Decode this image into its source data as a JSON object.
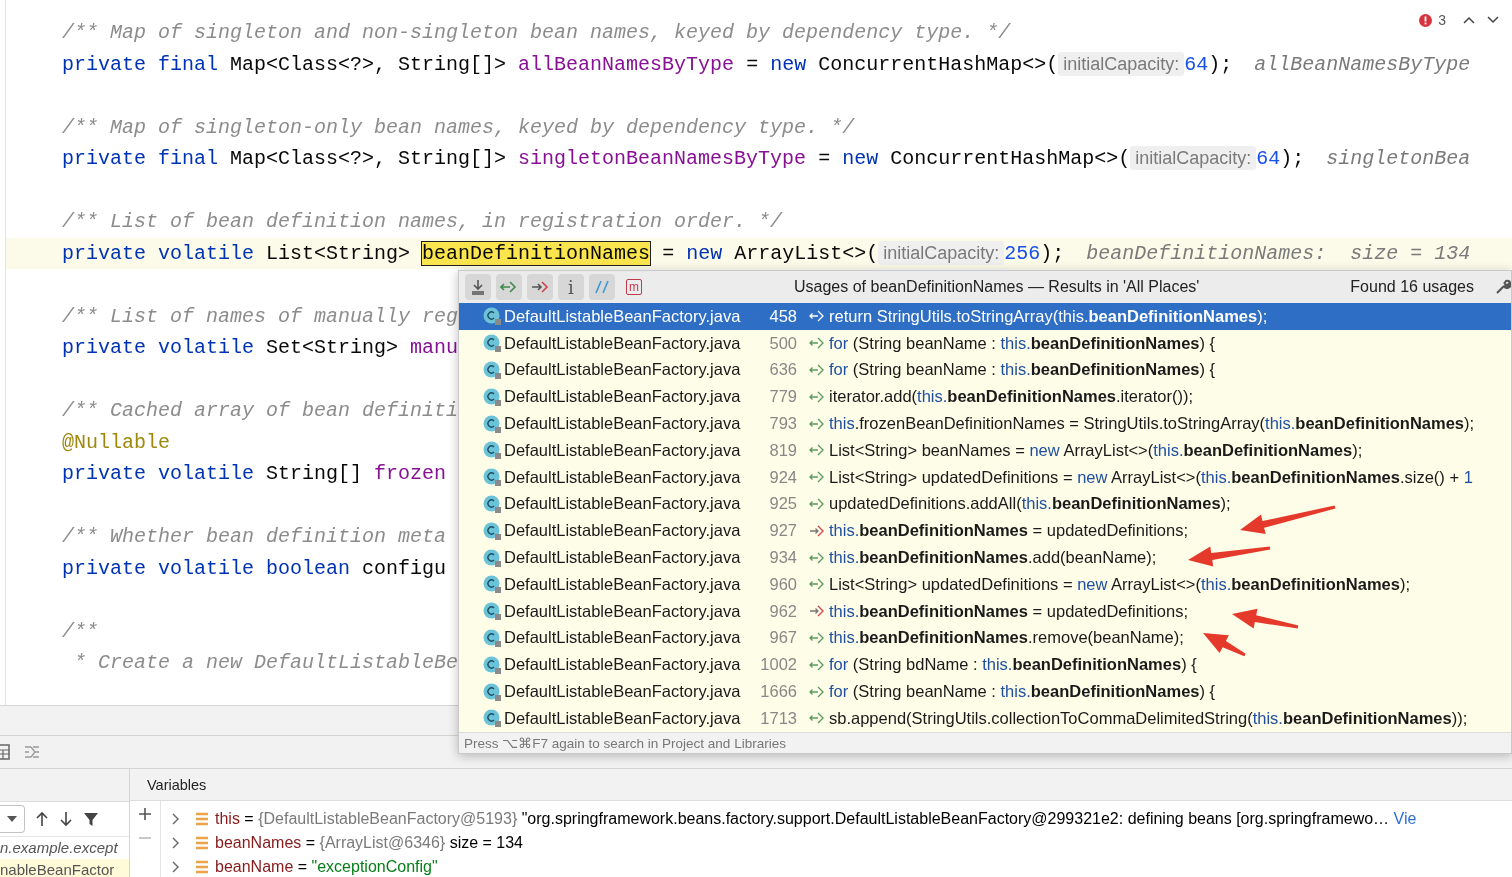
{
  "editor": {
    "error_count": "3",
    "blocks": [
      [
        {
          "current": false,
          "tokens": [
            {
              "t": "/** Map of singleton and non-singleton bean names, keyed by dependency type. */",
              "kind": "comment"
            }
          ]
        },
        {
          "current": false,
          "tokens": [
            {
              "t": "private final ",
              "kind": "keyword"
            },
            {
              "t": "Map<Class<?>, String[]> ",
              "kind": "plain"
            },
            {
              "t": "allBeanNamesByType",
              "kind": "field"
            },
            {
              "t": " = ",
              "kind": "plain"
            },
            {
              "t": "new ",
              "kind": "keyword"
            },
            {
              "t": "ConcurrentHashMap<>(",
              "kind": "plain"
            },
            {
              "t": "initialCapacity:",
              "kind": "hint"
            },
            {
              "t": "64",
              "kind": "number"
            },
            {
              "t": ");",
              "kind": "plain"
            },
            {
              "t": "allBeanNamesByType",
              "kind": "inline_value"
            }
          ]
        }
      ],
      [
        {
          "current": false,
          "tokens": [
            {
              "t": "/** Map of singleton-only bean names, keyed by dependency type. */",
              "kind": "comment"
            }
          ]
        },
        {
          "current": false,
          "tokens": [
            {
              "t": "private final ",
              "kind": "keyword"
            },
            {
              "t": "Map<Class<?>, String[]> ",
              "kind": "plain"
            },
            {
              "t": "singletonBeanNamesByType",
              "kind": "field"
            },
            {
              "t": " = ",
              "kind": "plain"
            },
            {
              "t": "new ",
              "kind": "keyword"
            },
            {
              "t": "ConcurrentHashMap<>(",
              "kind": "plain"
            },
            {
              "t": "initialCapacity:",
              "kind": "hint"
            },
            {
              "t": "64",
              "kind": "number"
            },
            {
              "t": ");",
              "kind": "plain"
            },
            {
              "t": "singletonBea",
              "kind": "inline_value"
            }
          ]
        }
      ],
      [
        {
          "current": false,
          "tokens": [
            {
              "t": "/** List of bean definition names, in registration order. */",
              "kind": "comment"
            }
          ]
        },
        {
          "current": true,
          "tokens": [
            {
              "t": "private volatile ",
              "kind": "keyword"
            },
            {
              "t": "List<String> ",
              "kind": "plain"
            },
            {
              "t": "beanDefinitionNames",
              "kind": "match"
            },
            {
              "t": " = ",
              "kind": "plain"
            },
            {
              "t": "new ",
              "kind": "keyword"
            },
            {
              "t": "ArrayList<>(",
              "kind": "plain"
            },
            {
              "t": "initialCapacity:",
              "kind": "hint"
            },
            {
              "t": "256",
              "kind": "number"
            },
            {
              "t": ");",
              "kind": "plain"
            },
            {
              "t": "beanDefinitionNames:  size = 134",
              "kind": "inline_value"
            }
          ]
        }
      ],
      [
        {
          "current": false,
          "tokens": [
            {
              "t": "/** List of names of manually reg",
              "kind": "comment"
            }
          ]
        },
        {
          "current": false,
          "tokens": [
            {
              "t": "private volatile ",
              "kind": "keyword"
            },
            {
              "t": "Set<String> ",
              "kind": "plain"
            },
            {
              "t": "manu",
              "kind": "field"
            }
          ]
        }
      ],
      [
        {
          "current": false,
          "tokens": [
            {
              "t": "/** Cached array of bean definiti",
              "kind": "comment"
            }
          ]
        },
        {
          "current": false,
          "tokens": [
            {
              "t": "@Nullable",
              "kind": "annotation"
            }
          ]
        },
        {
          "current": false,
          "tokens": [
            {
              "t": "private volatile ",
              "kind": "keyword"
            },
            {
              "t": "String[] ",
              "kind": "plain"
            },
            {
              "t": "frozen",
              "kind": "field"
            }
          ]
        }
      ],
      [
        {
          "current": false,
          "tokens": [
            {
              "t": "/** Whether bean definition meta",
              "kind": "comment"
            }
          ]
        },
        {
          "current": false,
          "tokens": [
            {
              "t": "private volatile boolean ",
              "kind": "keyword"
            },
            {
              "t": "configu",
              "kind": "plain"
            }
          ]
        }
      ],
      [
        {
          "current": false,
          "tokens": [
            {
              "t": "/**",
              "kind": "comment"
            }
          ]
        },
        {
          "current": false,
          "tokens": [
            {
              "t": " * Create a new DefaultListableBe",
              "kind": "comment"
            }
          ]
        }
      ]
    ]
  },
  "usages_popup": {
    "title": "Usages of beanDefinitionNames — Results in 'All Places'",
    "count": "Found 16 usages",
    "footer": "Press ⌥⌘F7 again to search in Project and Libraries",
    "toolbar": [
      {
        "kind": "collapse",
        "on": true
      },
      {
        "kind": "read",
        "on": true
      },
      {
        "kind": "write",
        "on": true
      },
      {
        "kind": "glyph",
        "text": "i",
        "on": true
      },
      {
        "kind": "comment",
        "on": true
      },
      {
        "kind": "glyph",
        "text": "m",
        "on": false
      }
    ],
    "rows": [
      {
        "file": "DefaultListableBeanFactory.java",
        "line": "458",
        "kind": "read",
        "selected": true,
        "code": [
          {
            "t": "return StringUtils.toStringArray(this.",
            "kind": "plain"
          },
          {
            "t": "beanDefinitionNames",
            "kind": "bold"
          },
          {
            "t": ");",
            "kind": "plain"
          }
        ]
      },
      {
        "file": "DefaultListableBeanFactory.java",
        "line": "500",
        "kind": "read",
        "selected": false,
        "code": [
          {
            "t": "for",
            "kind": "keyword"
          },
          {
            "t": " (String beanName : ",
            "kind": "plain"
          },
          {
            "t": "this.",
            "kind": "keyword"
          },
          {
            "t": "beanDefinitionNames",
            "kind": "bold"
          },
          {
            "t": ") {",
            "kind": "plain"
          }
        ]
      },
      {
        "file": "DefaultListableBeanFactory.java",
        "line": "636",
        "kind": "read",
        "selected": false,
        "code": [
          {
            "t": "for",
            "kind": "keyword"
          },
          {
            "t": " (String beanName : ",
            "kind": "plain"
          },
          {
            "t": "this.",
            "kind": "keyword"
          },
          {
            "t": "beanDefinitionNames",
            "kind": "bold"
          },
          {
            "t": ") {",
            "kind": "plain"
          }
        ]
      },
      {
        "file": "DefaultListableBeanFactory.java",
        "line": "779",
        "kind": "read",
        "selected": false,
        "code": [
          {
            "t": "iterator.add(",
            "kind": "plain"
          },
          {
            "t": "this.",
            "kind": "keyword"
          },
          {
            "t": "beanDefinitionNames",
            "kind": "bold"
          },
          {
            "t": ".iterator());",
            "kind": "plain"
          }
        ]
      },
      {
        "file": "DefaultListableBeanFactory.java",
        "line": "793",
        "kind": "read",
        "selected": false,
        "code": [
          {
            "t": "this",
            "kind": "keyword"
          },
          {
            "t": ".frozenBeanDefinitionNames = StringUtils.toStringArray(",
            "kind": "plain"
          },
          {
            "t": "this.",
            "kind": "keyword"
          },
          {
            "t": "beanDefinitionNames",
            "kind": "bold"
          },
          {
            "t": ");",
            "kind": "plain"
          }
        ]
      },
      {
        "file": "DefaultListableBeanFactory.java",
        "line": "819",
        "kind": "read",
        "selected": false,
        "code": [
          {
            "t": "List<String> beanNames = ",
            "kind": "plain"
          },
          {
            "t": "new",
            "kind": "keyword"
          },
          {
            "t": " ArrayList<>(",
            "kind": "plain"
          },
          {
            "t": "this.",
            "kind": "keyword"
          },
          {
            "t": "beanDefinitionNames",
            "kind": "bold"
          },
          {
            "t": ");",
            "kind": "plain"
          }
        ]
      },
      {
        "file": "DefaultListableBeanFactory.java",
        "line": "924",
        "kind": "read",
        "selected": false,
        "code": [
          {
            "t": "List<String> updatedDefinitions = ",
            "kind": "plain"
          },
          {
            "t": "new",
            "kind": "keyword"
          },
          {
            "t": " ArrayList<>(",
            "kind": "plain"
          },
          {
            "t": "this.",
            "kind": "keyword"
          },
          {
            "t": "beanDefinitionNames",
            "kind": "bold"
          },
          {
            "t": ".size() + ",
            "kind": "plain"
          },
          {
            "t": "1",
            "kind": "keyword"
          }
        ]
      },
      {
        "file": "DefaultListableBeanFactory.java",
        "line": "925",
        "kind": "read",
        "selected": false,
        "code": [
          {
            "t": "updatedDefinitions.addAll(",
            "kind": "plain"
          },
          {
            "t": "this.",
            "kind": "keyword"
          },
          {
            "t": "beanDefinitionNames",
            "kind": "bold"
          },
          {
            "t": ");",
            "kind": "plain"
          }
        ]
      },
      {
        "file": "DefaultListableBeanFactory.java",
        "line": "927",
        "kind": "write",
        "selected": false,
        "code": [
          {
            "t": "this.",
            "kind": "keyword"
          },
          {
            "t": "beanDefinitionNames",
            "kind": "bold"
          },
          {
            "t": " = updatedDefinitions;",
            "kind": "plain"
          }
        ]
      },
      {
        "file": "DefaultListableBeanFactory.java",
        "line": "934",
        "kind": "read",
        "selected": false,
        "code": [
          {
            "t": "this.",
            "kind": "keyword"
          },
          {
            "t": "beanDefinitionNames",
            "kind": "bold"
          },
          {
            "t": ".add(beanName);",
            "kind": "plain"
          }
        ]
      },
      {
        "file": "DefaultListableBeanFactory.java",
        "line": "960",
        "kind": "read",
        "selected": false,
        "code": [
          {
            "t": "List<String> updatedDefinitions = ",
            "kind": "plain"
          },
          {
            "t": "new",
            "kind": "keyword"
          },
          {
            "t": " ArrayList<>(",
            "kind": "plain"
          },
          {
            "t": "this.",
            "kind": "keyword"
          },
          {
            "t": "beanDefinitionNames",
            "kind": "bold"
          },
          {
            "t": ");",
            "kind": "plain"
          }
        ]
      },
      {
        "file": "DefaultListableBeanFactory.java",
        "line": "962",
        "kind": "write",
        "selected": false,
        "code": [
          {
            "t": "this.",
            "kind": "keyword"
          },
          {
            "t": "beanDefinitionNames",
            "kind": "bold"
          },
          {
            "t": " = updatedDefinitions;",
            "kind": "plain"
          }
        ]
      },
      {
        "file": "DefaultListableBeanFactory.java",
        "line": "967",
        "kind": "read",
        "selected": false,
        "code": [
          {
            "t": "this.",
            "kind": "keyword"
          },
          {
            "t": "beanDefinitionNames",
            "kind": "bold"
          },
          {
            "t": ".remove(beanName);",
            "kind": "plain"
          }
        ]
      },
      {
        "file": "DefaultListableBeanFactory.java",
        "line": "1002",
        "kind": "read",
        "selected": false,
        "code": [
          {
            "t": "for",
            "kind": "keyword"
          },
          {
            "t": " (String bdName : ",
            "kind": "plain"
          },
          {
            "t": "this.",
            "kind": "keyword"
          },
          {
            "t": "beanDefinitionNames",
            "kind": "bold"
          },
          {
            "t": ") {",
            "kind": "plain"
          }
        ]
      },
      {
        "file": "DefaultListableBeanFactory.java",
        "line": "1666",
        "kind": "read",
        "selected": false,
        "code": [
          {
            "t": "for",
            "kind": "keyword"
          },
          {
            "t": " (String beanName : ",
            "kind": "plain"
          },
          {
            "t": "this.",
            "kind": "keyword"
          },
          {
            "t": "beanDefinitionNames",
            "kind": "bold"
          },
          {
            "t": ") {",
            "kind": "plain"
          }
        ]
      },
      {
        "file": "DefaultListableBeanFactory.java",
        "line": "1713",
        "kind": "read",
        "selected": false,
        "code": [
          {
            "t": "sb.append(StringUtils.collectionToCommaDelimitedString(",
            "kind": "plain"
          },
          {
            "t": "this.",
            "kind": "keyword"
          },
          {
            "t": "beanDefinitionNames",
            "kind": "bold"
          },
          {
            "t": "));",
            "kind": "plain"
          }
        ]
      }
    ]
  },
  "debugger": {
    "variables_title": "Variables",
    "frames": [
      {
        "text": "n.example.except",
        "selected": false
      },
      {
        "text": "nableBeanFactor",
        "selected": true
      }
    ],
    "variables": [
      {
        "name": "this",
        "sep": "=",
        "value": [
          {
            "t": "{DefaultListableBeanFactory@5193}",
            "kind": "ref"
          },
          {
            "t": " \"org.springframework.beans.factory.support.DefaultListableBeanFactory@299321e2: defining beans [org.springframewo…",
            "kind": "plain"
          }
        ],
        "link": "Vie"
      },
      {
        "name": "beanNames",
        "sep": "=",
        "value": [
          {
            "t": "{ArrayList@6346}",
            "kind": "ref"
          },
          {
            "t": "  size = 134",
            "kind": "plain"
          }
        ]
      },
      {
        "name": "beanName",
        "sep": "=",
        "value": [
          {
            "t": "\"exceptionConfig\"",
            "kind": "string"
          }
        ]
      }
    ]
  }
}
